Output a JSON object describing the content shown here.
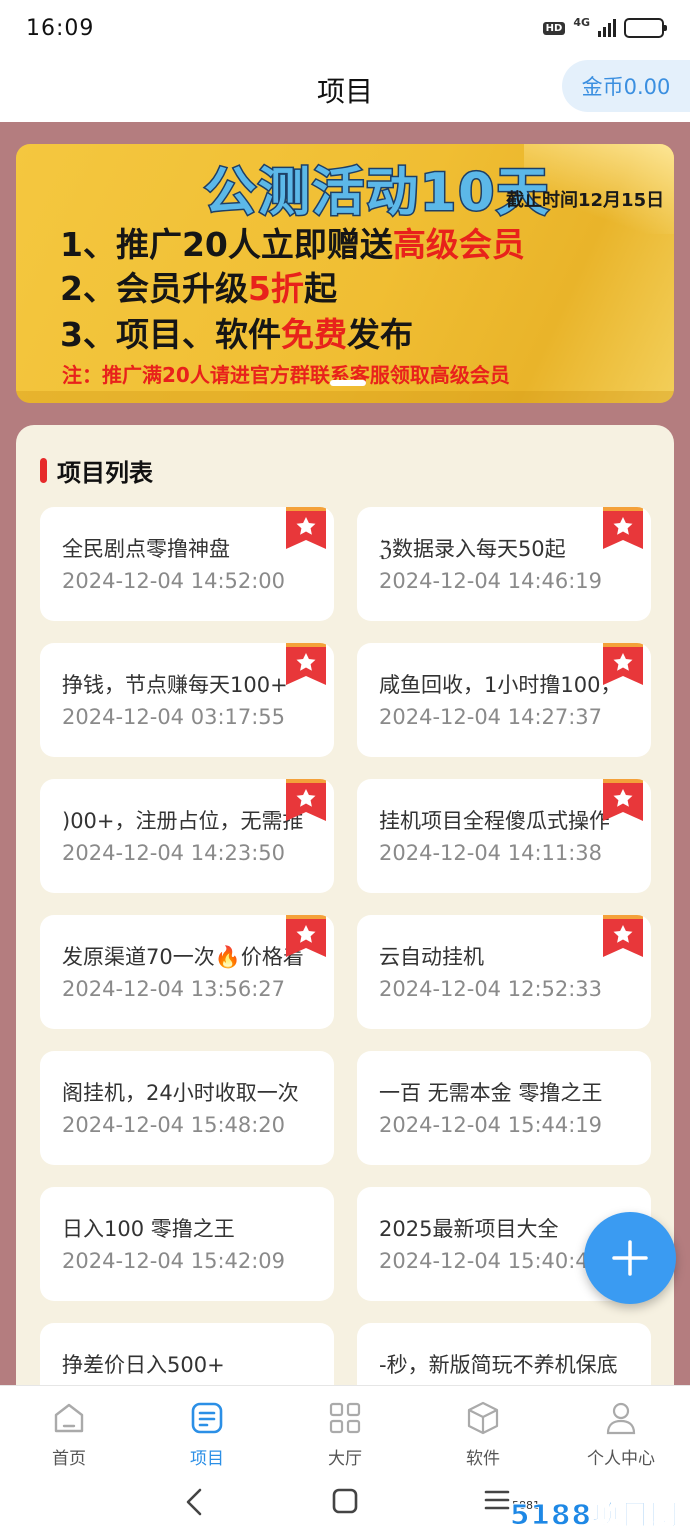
{
  "status_bar": {
    "time": "16:09",
    "hd": "HD",
    "network": "4G",
    "battery_level": 0.75
  },
  "header": {
    "title": "项目",
    "coin_label": "金币0.00"
  },
  "banner": {
    "title": "公测活动10天",
    "deadline": "截止时间12月15日",
    "line1_a": "1、推广20人立即赠送",
    "line1_b": "高级会员",
    "line2_a": "2、会员升级",
    "line2_b": "5折",
    "line2_c": "起",
    "line3_a": "3、项目、软件",
    "line3_b": "免费",
    "line3_c": "发布",
    "note": "注：推广满20人请进官方群联系客服领取高级会员",
    "colors": {
      "title": "#5cb8e8",
      "highlight": "#e8221b",
      "background": "#f0be33"
    }
  },
  "list": {
    "section_title": "项目列表",
    "items": [
      {
        "title": "全民剧点零撸神盘",
        "date": "2024-12-04 14:52:00",
        "featured": true
      },
      {
        "title": "ℨ数据录入每天50起",
        "date": "2024-12-04 14:46:19",
        "featured": true
      },
      {
        "title": "挣钱，节点赚每天100+",
        "date": "2024-12-04 03:17:55",
        "featured": true
      },
      {
        "title": "咸鱼回收，1小时撸100，",
        "date": "2024-12-04 14:27:37",
        "featured": true
      },
      {
        "title": ")00+，注册占位，无需推",
        "date": "2024-12-04 14:23:50",
        "featured": true
      },
      {
        "title": "挂机项目全程傻瓜式操作",
        "date": "2024-12-04 14:11:38",
        "featured": true
      },
      {
        "title": "发原渠道70一次🔥价格着",
        "date": "2024-12-04 13:56:27",
        "featured": true
      },
      {
        "title": "云自动挂机",
        "date": "2024-12-04 12:52:33",
        "featured": true
      },
      {
        "title": "阁挂机，24小时收取一次",
        "date": "2024-12-04 15:48:20",
        "featured": false
      },
      {
        "title": "一百 无需本金 零撸之王",
        "date": "2024-12-04 15:44:19",
        "featured": false
      },
      {
        "title": "日入100 零撸之王",
        "date": "2024-12-04 15:42:09",
        "featured": false
      },
      {
        "title": "2025最新项目大全",
        "date": "2024-12-04 15:40:44",
        "featured": false
      },
      {
        "title": "挣差价日入500+",
        "date": "",
        "featured": false
      },
      {
        "title": "-秒，新版简玩不养机保底",
        "date": "",
        "featured": false
      }
    ]
  },
  "fab": {
    "icon": "plus-icon"
  },
  "tabbar": {
    "tabs": [
      {
        "label": "首页",
        "icon": "home-icon",
        "active": false
      },
      {
        "label": "项目",
        "icon": "project-icon",
        "active": true
      },
      {
        "label": "大厅",
        "icon": "grid-icon",
        "active": false
      },
      {
        "label": "软件",
        "icon": "cube-icon",
        "active": false
      },
      {
        "label": "个人中心",
        "icon": "user-icon",
        "active": false
      }
    ]
  },
  "navbar": {
    "watermark": "5188项目网",
    "watermark_sub": "5881"
  },
  "colors": {
    "accent": "#2b8fe6",
    "page_bg": "#b47d7f",
    "panel_bg": "#f6f1e1",
    "ribbon": "#e8373a"
  }
}
